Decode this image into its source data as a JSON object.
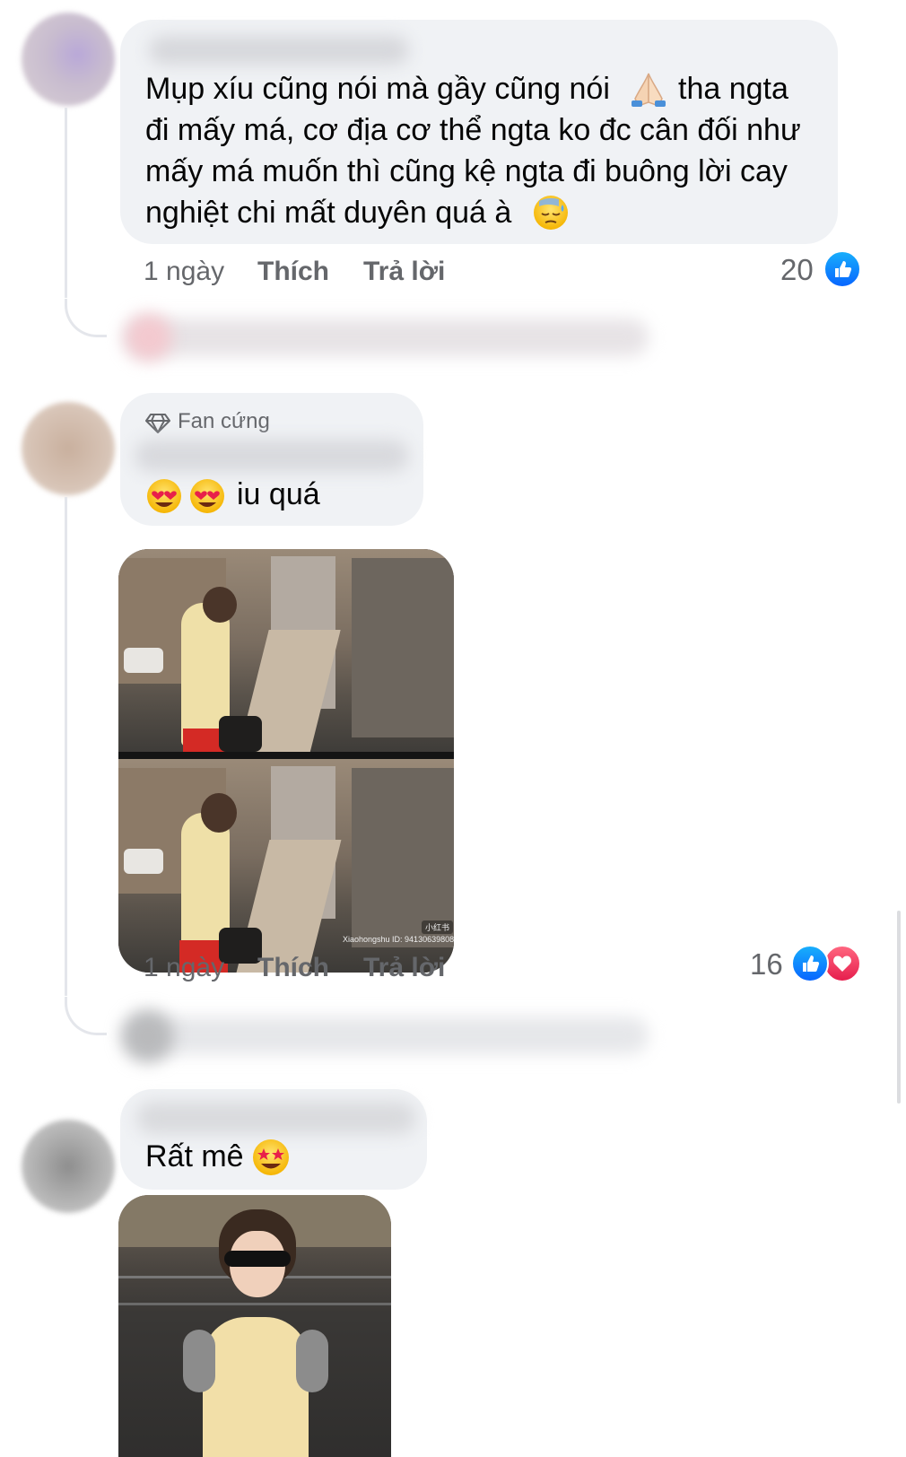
{
  "comments": [
    {
      "text_lines": [
        "Mụp xíu cũng nói mà gầy cũng nói",
        "tha ngta",
        "đi mấy má, cơ địa cơ thể ngta ko đc cân đối như",
        "mấy má muốn thì cũng kệ ngta đi buông lời cay",
        "nghiệt chi mất duyên quá à"
      ],
      "emojis": [
        "folded-hands",
        "downcast-sweat-face"
      ],
      "time": "1 ngày",
      "like_label": "Thích",
      "reply_label": "Trả lời",
      "reaction_count": "20",
      "reactions": [
        "like"
      ]
    },
    {
      "badge": "Fan cứng",
      "text": "iu quá",
      "emojis": [
        "heart-eyes",
        "heart-eyes"
      ],
      "watermark": "Xiaohongshu ID: 94130639808",
      "watermark_logo": "小红书",
      "time": "1 ngày",
      "like_label": "Thích",
      "reply_label": "Trả lời",
      "reaction_count": "16",
      "reactions": [
        "like",
        "love"
      ]
    },
    {
      "text": "Rất mê",
      "emojis": [
        "star-struck"
      ]
    }
  ],
  "colors": {
    "bubble": "#f0f2f5",
    "secondary_text": "#65676b",
    "like_blue": "#0866ff",
    "love_red": "#e61e4d",
    "thread_line": "#e4e6eb"
  }
}
